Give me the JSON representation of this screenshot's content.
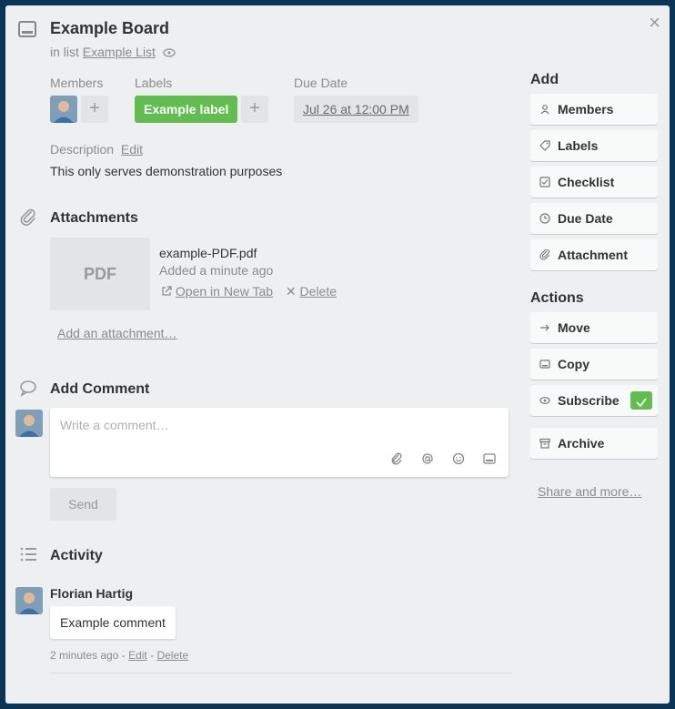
{
  "card": {
    "title": "Example Board",
    "in_list_prefix": "in list",
    "list_name": "Example List",
    "close_glyph": "×"
  },
  "members": {
    "label": "Members",
    "add_glyph": "+"
  },
  "labels": {
    "label": "Labels",
    "items": [
      "Example label"
    ],
    "add_glyph": "+",
    "label_color": "#61bd4f"
  },
  "due_date": {
    "label": "Due Date",
    "value": "Jul 26 at 12:00 PM"
  },
  "description": {
    "label": "Description",
    "edit": "Edit",
    "text": "This only serves demonstration purposes"
  },
  "attachments": {
    "title": "Attachments",
    "file": {
      "thumb": "PDF",
      "name": "example-PDF.pdf",
      "added": "Added a minute ago",
      "open": "Open in New Tab",
      "delete": "Delete"
    },
    "add": "Add an attachment…"
  },
  "comment": {
    "title": "Add Comment",
    "placeholder": "Write a comment…",
    "send": "Send"
  },
  "activity": {
    "title": "Activity",
    "author": "Florian Hartig",
    "text": "Example comment",
    "time": "2 minutes ago",
    "sep1": "-",
    "edit": "Edit",
    "sep2": "-",
    "delete": "Delete"
  },
  "sidebar": {
    "add_title": "Add",
    "add_items": [
      "Members",
      "Labels",
      "Checklist",
      "Due Date",
      "Attachment"
    ],
    "actions_title": "Actions",
    "action_items": [
      "Move",
      "Copy",
      "Subscribe",
      "Archive"
    ],
    "share": "Share and more…"
  },
  "colors": {
    "accent_green": "#61bd4f",
    "frame": "#0a3556",
    "panel": "#edeff0"
  }
}
